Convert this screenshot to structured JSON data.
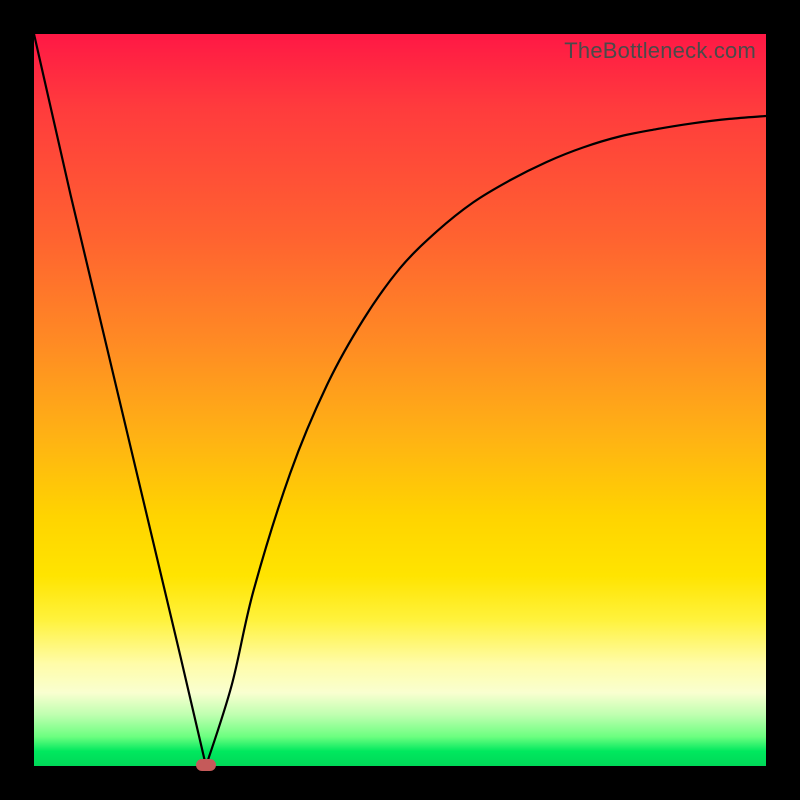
{
  "watermark": "TheBottleneck.com",
  "chart_data": {
    "type": "line",
    "title": "",
    "xlabel": "",
    "ylabel": "",
    "xlim": [
      0,
      100
    ],
    "ylim": [
      0,
      100
    ],
    "min_marker": {
      "x": 23.5,
      "y": 0
    },
    "series": [
      {
        "name": "bottleneck-curve",
        "x": [
          0,
          5,
          10,
          15,
          20,
          23.5,
          27,
          30,
          35,
          40,
          45,
          50,
          55,
          60,
          65,
          70,
          75,
          80,
          85,
          90,
          95,
          100
        ],
        "values": [
          100,
          78,
          57,
          36,
          15,
          0,
          11,
          24,
          40,
          52,
          61,
          68,
          73,
          77,
          80,
          82.5,
          84.5,
          86,
          87,
          87.8,
          88.4,
          88.8
        ]
      }
    ]
  },
  "colors": {
    "curve": "#000000",
    "marker": "#c55a5a"
  }
}
